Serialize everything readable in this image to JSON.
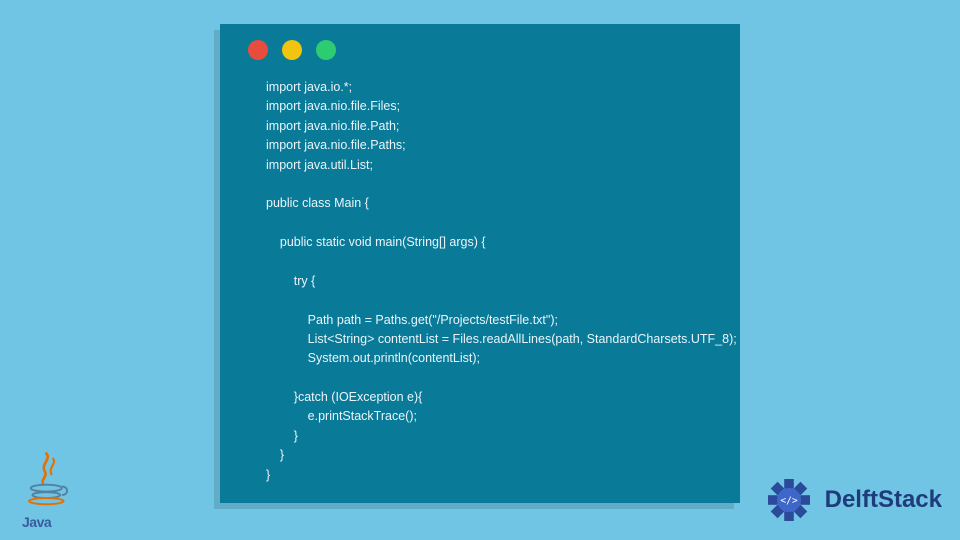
{
  "window": {
    "dots": {
      "red": "#e74c3c",
      "yellow": "#f1c40f",
      "green": "#2ecc71"
    }
  },
  "code": {
    "lines": [
      "import java.io.*;",
      "import java.nio.file.Files;",
      "import java.nio.file.Path;",
      "import java.nio.file.Paths;",
      "import java.util.List;",
      "",
      "public class Main {",
      "",
      "    public static void main(String[] args) {",
      "",
      "        try {",
      "",
      "            Path path = Paths.get(\"/Projects/testFile.txt\");",
      "            List<String> contentList = Files.readAllLines(path, StandardCharsets.UTF_8);",
      "            System.out.println(contentList);",
      "",
      "        }catch (IOException e){",
      "            e.printStackTrace();",
      "        }",
      "    }",
      "}"
    ]
  },
  "logos": {
    "java_label": "Java",
    "delft_label": "DelftStack"
  }
}
